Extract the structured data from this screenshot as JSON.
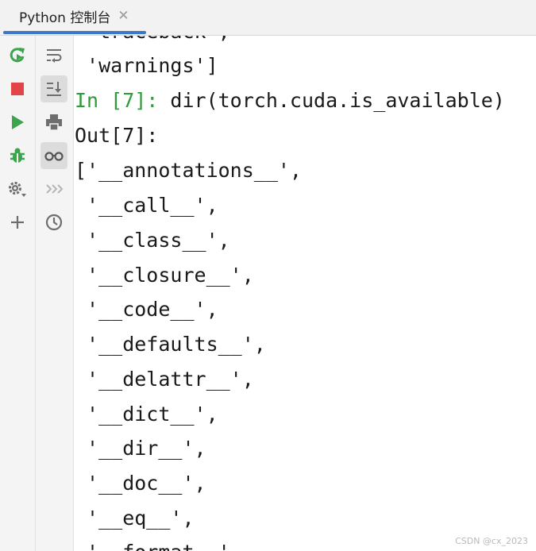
{
  "tab": {
    "label": "Python 控制台",
    "close": "✕"
  },
  "toolbar_left": [
    {
      "name": "rerun-icon"
    },
    {
      "name": "stop-icon"
    },
    {
      "name": "run-icon"
    },
    {
      "name": "debug-icon"
    },
    {
      "name": "settings-icon"
    },
    {
      "name": "add-icon"
    }
  ],
  "toolbar_right": [
    {
      "name": "soft-wrap-icon"
    },
    {
      "name": "scroll-to-end-icon"
    },
    {
      "name": "print-icon"
    },
    {
      "name": "show-variables-icon"
    },
    {
      "name": "execute-icon"
    },
    {
      "name": "history-icon"
    }
  ],
  "console": {
    "partial_top": " 'traceback',",
    "warnings": " 'warnings']",
    "in_prompt": "In [7]:",
    "in_code": " dir(torch.cuda.is_available)",
    "out_prompt": "Out[7]:",
    "out_lines": [
      "['__annotations__',",
      " '__call__',",
      " '__class__',",
      " '__closure__',",
      " '__code__',",
      " '__defaults__',",
      " '__delattr__',",
      " '__dict__',",
      " '__dir__',",
      " '__doc__',",
      " '__eq__',",
      " '__format__',"
    ]
  },
  "watermark": "CSDN @cx_2023"
}
